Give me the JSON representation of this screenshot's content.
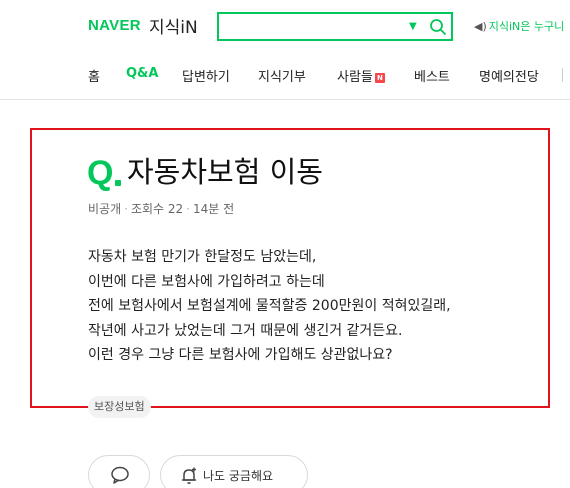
{
  "header": {
    "brand": "NAVER",
    "service": "지식iN",
    "search": {
      "value": "",
      "placeholder": ""
    },
    "notice_text": "지식iN은 누구니"
  },
  "nav": {
    "items": [
      {
        "label": "홈",
        "active": false
      },
      {
        "label": "Q&A",
        "active": true
      },
      {
        "label": "답변하기",
        "active": false
      },
      {
        "label": "지식기부",
        "active": false
      },
      {
        "label": "사람들",
        "active": false,
        "badge": "N"
      },
      {
        "label": "베스트",
        "active": false
      },
      {
        "label": "명예의전당",
        "active": false
      }
    ]
  },
  "question": {
    "q_mark": "Q",
    "title": "자동차보험 이동",
    "author": "비공개",
    "views_label": "조회수 22",
    "time": "14분 전",
    "body": [
      "자동차 보험 만기가 한달정도 남았는데,",
      "이번에 다른 보험사에 가입하려고 하는데",
      "전에 보험사에서 보험설계에 물적할증 200만원이 적혀있길래,",
      "작년에 사고가 났었는데 그거 때문에 생긴거 같거든요.",
      "이런 경우 그냥 다른 보험사에 가입해도 상관없나요?"
    ],
    "tag": "보장성보험"
  },
  "actions": {
    "curious_label": "나도 궁금해요"
  },
  "colors": {
    "accent": "#03c75a",
    "highlight": "#e0141c",
    "badge": "#f5484d"
  }
}
